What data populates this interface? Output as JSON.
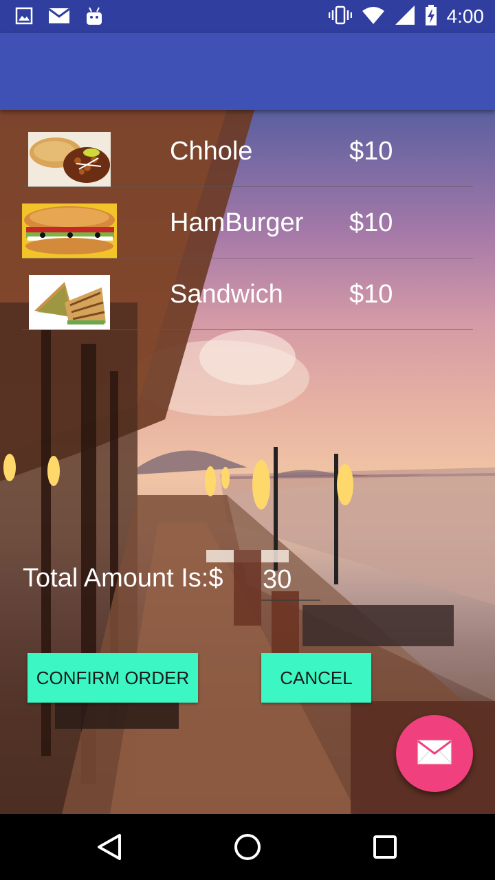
{
  "status_bar": {
    "time": "4:00",
    "left_icons": [
      "image-icon",
      "email-icon",
      "android-icon"
    ],
    "right_icons": [
      "vibrate-icon",
      "wifi-icon",
      "signal-icon",
      "battery-charging-icon"
    ]
  },
  "menu": {
    "items": [
      {
        "name": "Chhole",
        "price": "$10",
        "image": "chhole-photo"
      },
      {
        "name": "HamBurger",
        "price": "$10",
        "image": "hamburger-photo"
      },
      {
        "name": "Sandwich",
        "price": "$10",
        "image": "sandwich-photo"
      }
    ]
  },
  "total": {
    "label": "Total Amount Is:$",
    "value": "30"
  },
  "buttons": {
    "confirm": "CONFIRM ORDER",
    "cancel": "CANCEL"
  },
  "fab": {
    "icon": "email-icon"
  },
  "nav": [
    "back-icon",
    "home-icon",
    "recents-icon"
  ],
  "colors": {
    "status_bar": "#303f9f",
    "app_bar": "#3f51b5",
    "button": "#3cf7c3",
    "fab": "#f0417e"
  }
}
